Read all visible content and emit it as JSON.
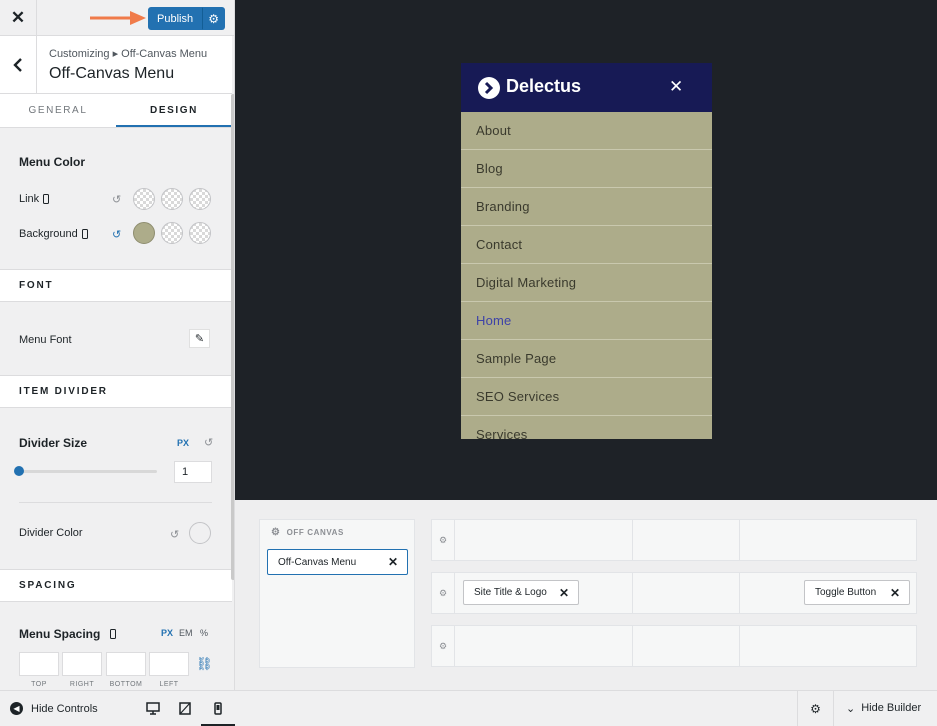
{
  "customizer": {
    "close_icon": "close-icon",
    "publish_label": "Publish",
    "breadcrumb": "Customizing ▸ Off-Canvas Menu",
    "section_title": "Off-Canvas Menu",
    "tabs": [
      {
        "label": "GENERAL",
        "active": false
      },
      {
        "label": "DESIGN",
        "active": true
      }
    ]
  },
  "design": {
    "menu_color_title": "Menu Color",
    "link_label": "Link",
    "background_label": "Background",
    "background_color": "#adac8a",
    "font_band": "FONT",
    "menu_font_label": "Menu Font",
    "item_divider_band": "ITEM DIVIDER",
    "divider_size_title": "Divider Size",
    "divider_unit": "PX",
    "divider_value": "1",
    "divider_slider_fraction": 0,
    "divider_color_label": "Divider Color",
    "spacing_band": "SPACING",
    "menu_spacing_title": "Menu Spacing",
    "spacing_units": [
      "PX",
      "EM",
      "%"
    ],
    "spacing_active_unit": "PX",
    "spacing_fields": [
      "TOP",
      "RIGHT",
      "BOTTOM",
      "LEFT"
    ]
  },
  "preview": {
    "brand": "Delectus",
    "header_color": "#171a55",
    "menu_bg_color": "#adac8a",
    "current_item_color": "#3d42a8",
    "menu_items": [
      "About",
      "Blog",
      "Branding",
      "Contact",
      "Digital Marketing",
      "Home",
      "Sample Page",
      "SEO Services",
      "Services"
    ],
    "current_item": "Home"
  },
  "builder": {
    "off_canvas_label": "OFF CANVAS",
    "off_canvas_item": "Off-Canvas Menu",
    "site_title_item": "Site Title & Logo",
    "toggle_item": "Toggle Button"
  },
  "footer": {
    "hide_controls": "Hide Controls",
    "hide_builder": "Hide Builder",
    "active_device": "mobile"
  }
}
